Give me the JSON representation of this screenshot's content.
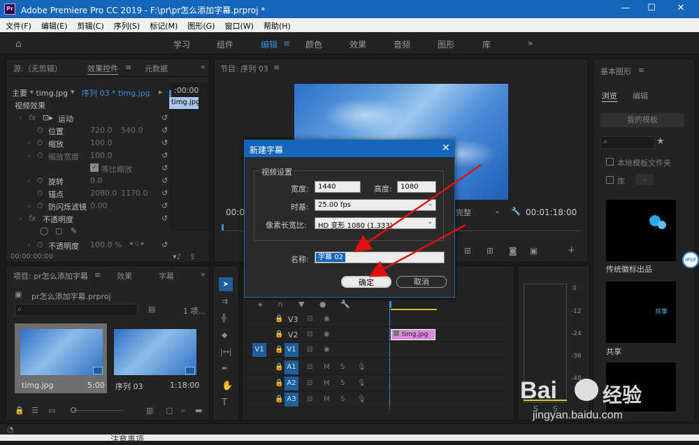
{
  "titlebar": {
    "logo": "Pr",
    "title": "Adobe Premiere Pro CC 2019 - F:\\pr\\pr怎么添加字幕.prproj *",
    "minimize": "—",
    "maximize": "☐",
    "close": "✕"
  },
  "menu": [
    "文件(F)",
    "编辑(E)",
    "剪辑(C)",
    "序列(S)",
    "标记(M)",
    "图形(G)",
    "窗口(W)",
    "帮助(H)"
  ],
  "workspace_tabs": [
    "学习",
    "组件",
    "编辑",
    "颜色",
    "效果",
    "音频",
    "图形",
    "库"
  ],
  "workspace_more": "»",
  "source_panel": {
    "tabs": [
      "源:（无剪辑）",
      "效果控件",
      "元数据"
    ],
    "more": "»",
    "master_label": "主要 * timg.jpg",
    "sequence_label": "序列 03 * timg.jpg",
    "timecode_small": ":00:00",
    "clip_chip": "timg.jpg",
    "video_effects": "视频效果",
    "fx": "fx",
    "rows": [
      {
        "name": "运动",
        "v1": "",
        "v2": ""
      },
      {
        "name": "位置",
        "v1": "720.0",
        "v2": "540.0"
      },
      {
        "name": "缩放",
        "v1": "100.0",
        "v2": ""
      },
      {
        "name": "缩放宽度",
        "v1": "100.0",
        "v2": ""
      },
      {
        "name": "等比缩放",
        "v1": "",
        "v2": ""
      },
      {
        "name": "旋转",
        "v1": "0.0",
        "v2": ""
      },
      {
        "name": "锚点",
        "v1": "2080.0",
        "v2": "1170.0"
      },
      {
        "name": "防闪烁滤镜",
        "v1": "0.00",
        "v2": ""
      },
      {
        "name": "不透明度",
        "v1": "",
        "v2": ""
      },
      {
        "name": "不透明度",
        "v1": "100.0 %",
        "v2": ""
      }
    ],
    "timecode": "00:00:00:00"
  },
  "program_panel": {
    "title": "节目: 序列 03",
    "tc_left": "00:0",
    "tc_right": "00:01:18:00",
    "fit": "完整"
  },
  "graphics_panel": {
    "title": "基本图形",
    "tabs": [
      "浏览",
      "编辑"
    ],
    "my_templates": "我的模板",
    "local_templates": "本地模板文件夹",
    "library": "库",
    "templates": [
      {
        "name": "传统徽标出品",
        "thumb_text": ""
      },
      {
        "name": "共享",
        "thumb_text": "共享"
      }
    ]
  },
  "project_panel": {
    "tabs": [
      "项目: pr怎么添加字幕",
      "效果",
      "字幕"
    ],
    "file": "pr怎么添加字幕.prproj",
    "count": "1 项...",
    "items": [
      {
        "name": "timg.jpg",
        "duration": "5:00"
      },
      {
        "name": "序列 03",
        "duration": "1:18:00"
      }
    ]
  },
  "timeline": {
    "tracks": [
      {
        "label": "V3",
        "src": ""
      },
      {
        "label": "V2",
        "src": ""
      },
      {
        "label": "V1",
        "src": "V1"
      },
      {
        "label": "A1",
        "src": ""
      },
      {
        "label": "A2",
        "src": ""
      },
      {
        "label": "A3",
        "src": ""
      }
    ],
    "clip": "timg.jpg",
    "meter_labels": [
      "0",
      "-12",
      "-24",
      "-36",
      "-48"
    ]
  },
  "dialog": {
    "title": "新建字幕",
    "close": "✕",
    "group": "视频设置",
    "width_label": "宽度:",
    "width_value": "1440",
    "height_label": "高度:",
    "height_value": "1080",
    "timebase_label": "时基:",
    "timebase_value": "25.00 fps",
    "par_label": "像素长宽比:",
    "par_value": "HD 变形 1080 (1.333)",
    "name_label": "名称:",
    "name_value": "字幕 02",
    "ok": "确定",
    "cancel": "取消"
  },
  "watermark": {
    "brand": "Bai",
    "brand2": "经验",
    "url": "jingyan.baidu.com",
    "side": "iFLY"
  },
  "bottom_text": "注意事项",
  "colors": {
    "accent": "#1565b8",
    "highlight": "#3b8edb",
    "arrow": "#e01010"
  }
}
